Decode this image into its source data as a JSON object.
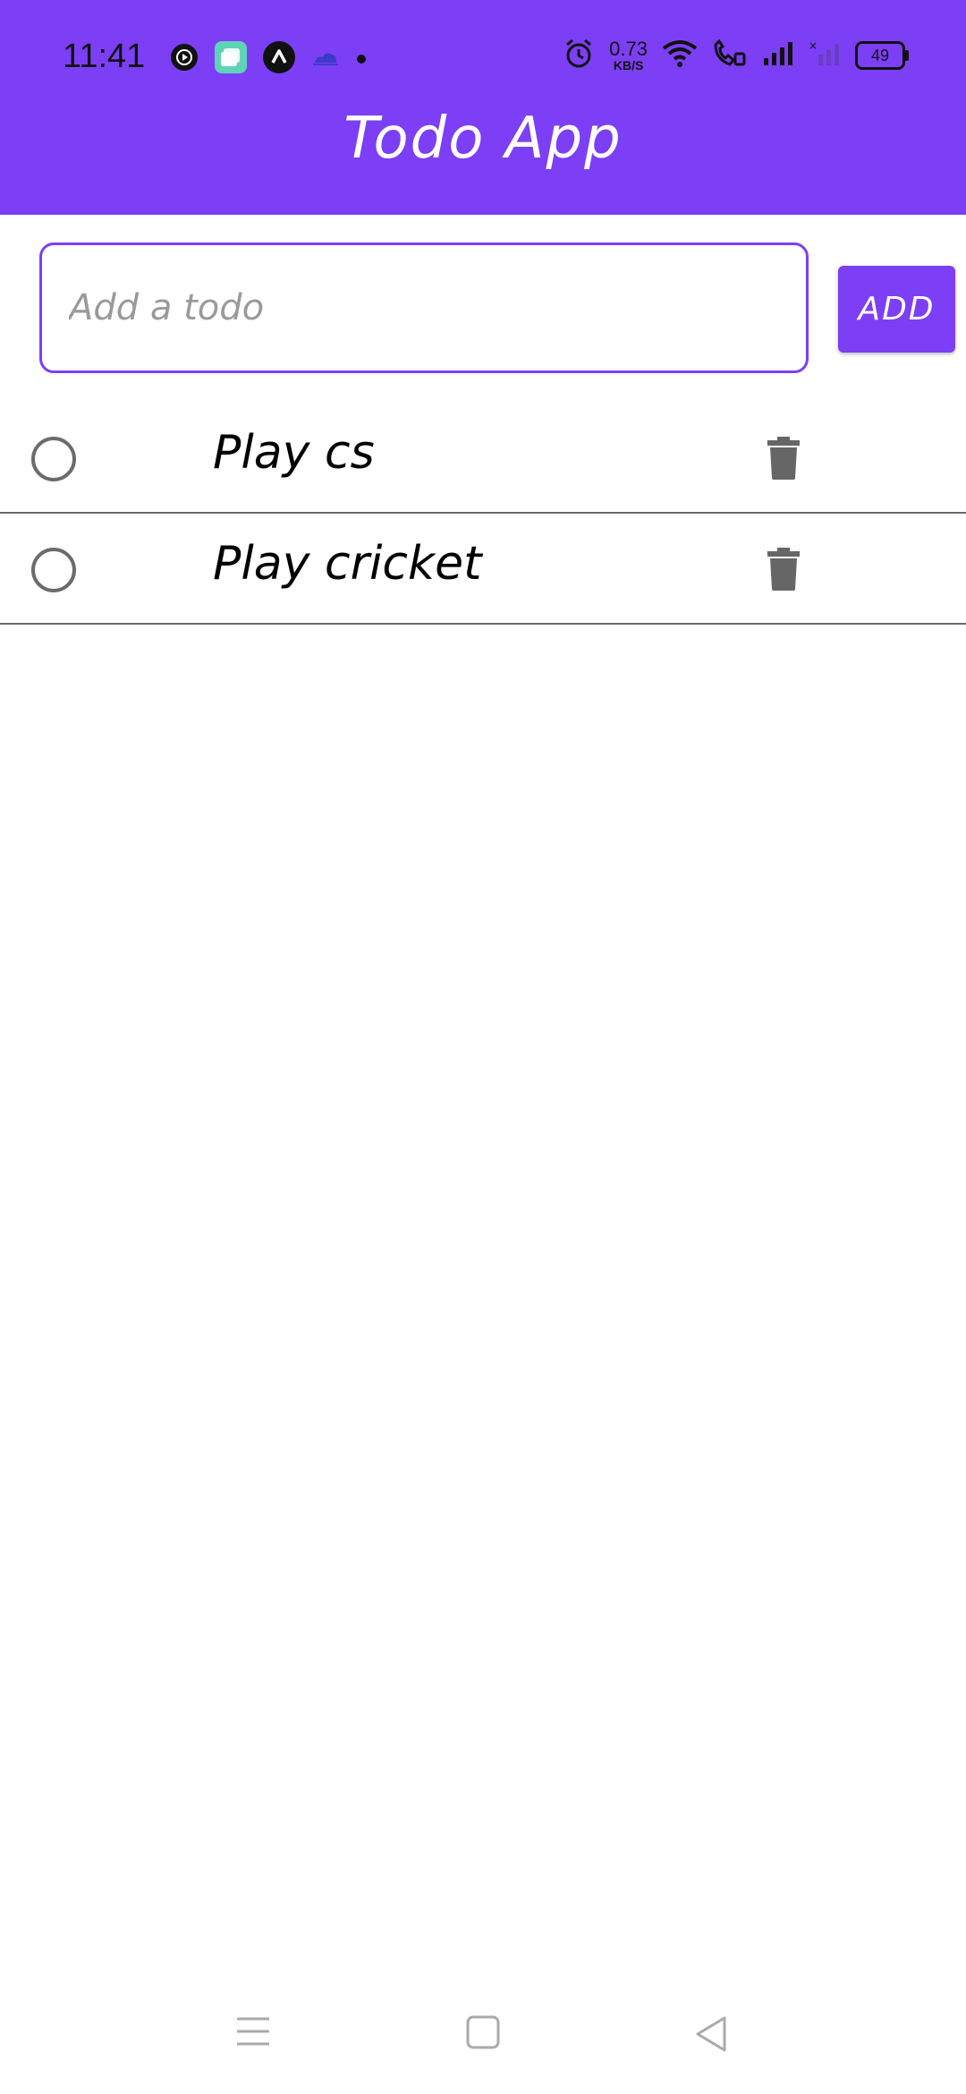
{
  "status_bar": {
    "time": "11:41",
    "network_speed_value": "0.73",
    "network_speed_unit": "KB/S",
    "battery": "49",
    "icons_left": [
      "play-circle-icon",
      "layers-app-icon",
      "arrow-app-icon",
      "cloud-icon",
      "dot-icon"
    ],
    "icons_right": [
      "alarm-icon",
      "wifi-icon",
      "wifi-call-icon",
      "signal-icon",
      "signal-off-icon"
    ]
  },
  "header": {
    "title": "Todo App",
    "color": "#7c3ff5"
  },
  "add_form": {
    "placeholder": "Add a todo",
    "value": "",
    "add_label": "ADD"
  },
  "todos": [
    {
      "text": "Play cs",
      "completed": false
    },
    {
      "text": "Play cricket",
      "completed": false
    }
  ],
  "nav_bar": {
    "icons": [
      "menu-icon",
      "home-square-icon",
      "back-triangle-icon"
    ]
  }
}
